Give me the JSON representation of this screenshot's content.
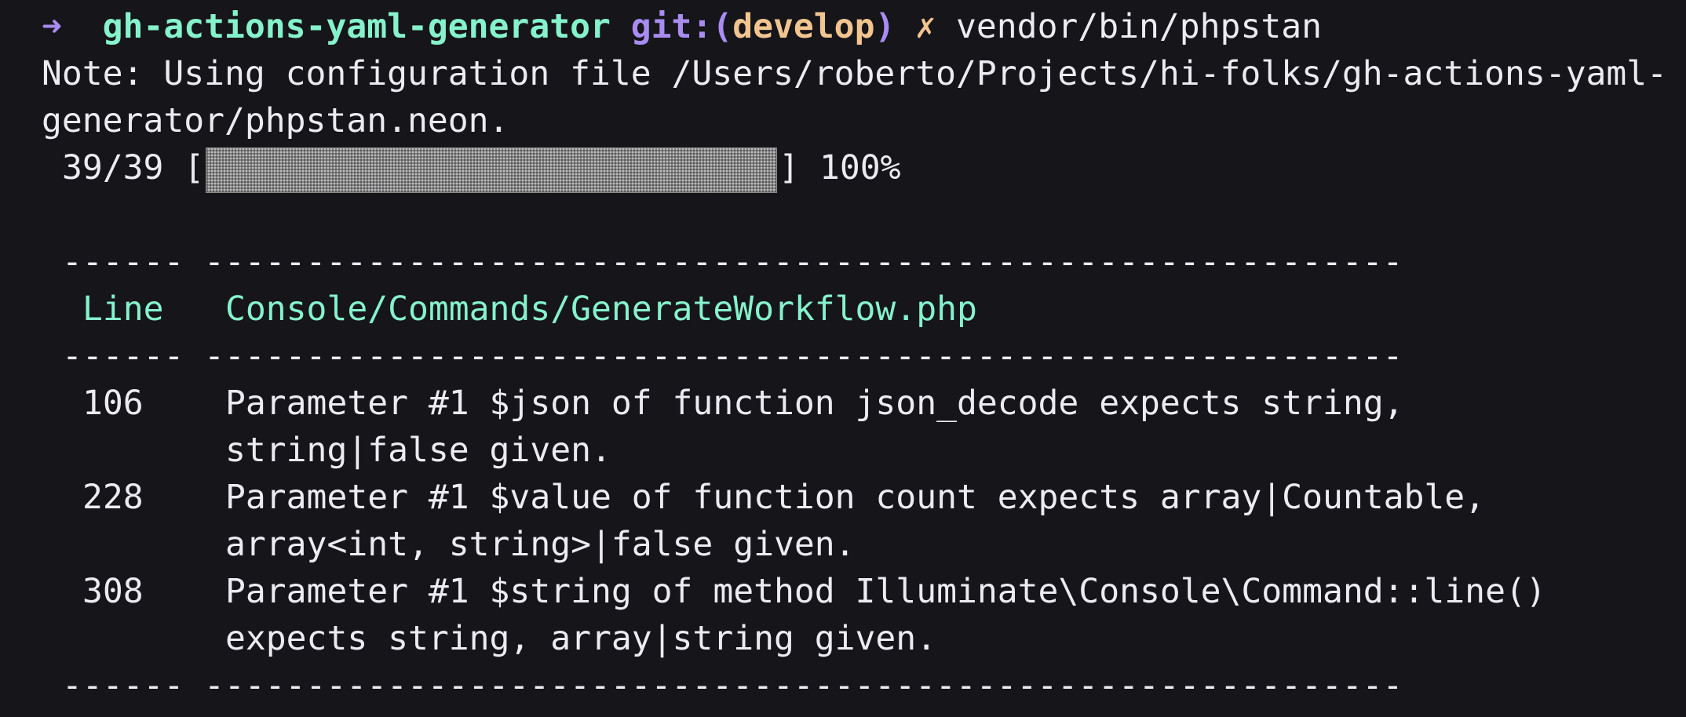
{
  "prompt": {
    "arrow": "➜",
    "directory": "gh-actions-yaml-generator",
    "git_prefix": "git:(",
    "branch": "develop",
    "git_suffix": ")",
    "dirty_marker": "✗",
    "command": "vendor/bin/phpstan"
  },
  "note": {
    "line1": "Note: Using configuration file /Users/roberto/Projects/hi-folks/gh-actions-yaml-",
    "line2": "generator/phpstan.neon."
  },
  "progress": {
    "count": "39/39",
    "open_bracket": "[",
    "close_bracket": "]",
    "percent_label": "100%",
    "fraction": 1.0
  },
  "table": {
    "separator_short": "------",
    "separator_long": "-----------------------------------------------------------",
    "header_line": "Line",
    "header_file": "Console/Commands/GenerateWorkflow.php",
    "rows": [
      {
        "line": "106",
        "message1": "Parameter #1 $json of function json_decode expects string,",
        "message2": "string|false given."
      },
      {
        "line": "228",
        "message1": "Parameter #1 $value of function count expects array|Countable,",
        "message2": "array<int, string>|false given."
      },
      {
        "line": "308",
        "message1": "Parameter #1 $string of method Illuminate\\Console\\Command::line()",
        "message2": "expects string, array|string given."
      }
    ]
  },
  "colors": {
    "background": "#16161a",
    "text": "#ecebf2",
    "accent_green": "#86f2cc",
    "accent_purple": "#a98cf2",
    "accent_orange": "#f2c590"
  }
}
